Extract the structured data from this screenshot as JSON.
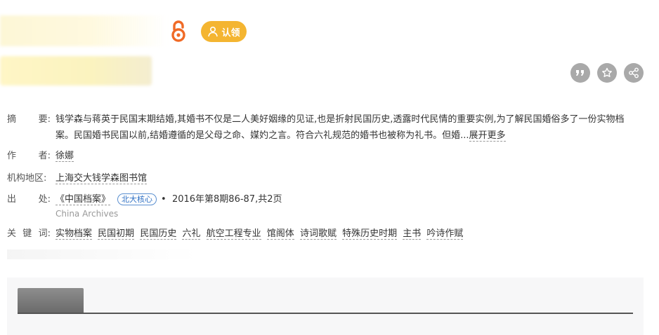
{
  "header": {
    "claim_label": "认领"
  },
  "icons": {
    "open_access": "open-access-icon",
    "claim": "user-icon",
    "cite": "quote-icon",
    "favorite": "star-icon",
    "share": "share-icon"
  },
  "colors": {
    "claim_bg": "#f4b531",
    "open_access": "#f06a26",
    "action_icon_bg": "#a9a9a9",
    "badge": "#2d6fc4"
  },
  "meta": {
    "abstract": {
      "label_left": "摘",
      "label_right": "要:",
      "text": "钱学森与蒋英于民国末期结婚,其婚书不仅是二人美好姻缘的见证,也是折射民国历史,透露时代民情的重要实例,为了解民国婚俗多了一份实物档案。民国婚书民国以前,结婚遵循的是父母之命、媒妁之言。符合六礼规范的婚书也被称为礼书。但婚...",
      "more_label": "展开更多"
    },
    "author": {
      "label_left": "作",
      "label_right": "者:",
      "value": "徐娜"
    },
    "institution": {
      "label": "机构地区:",
      "value": "上海交大钱学森图书馆"
    },
    "source": {
      "label_left": "出",
      "label_right": "处:",
      "journal": "《中国档案》",
      "badge": "北大核心",
      "separator": "•",
      "issue": "2016年第8期86-87,共2页",
      "english_name": "China Archives"
    },
    "keywords": {
      "label_left": "关",
      "label_mid": "键",
      "label_right": "词:",
      "items": [
        "实物档案",
        "民国初期",
        "民国历史",
        "六礼",
        "航空工程专业",
        "馆阁体",
        "诗词歌赋",
        "特殊历史时期",
        "主书",
        "吟诗作赋"
      ]
    }
  }
}
